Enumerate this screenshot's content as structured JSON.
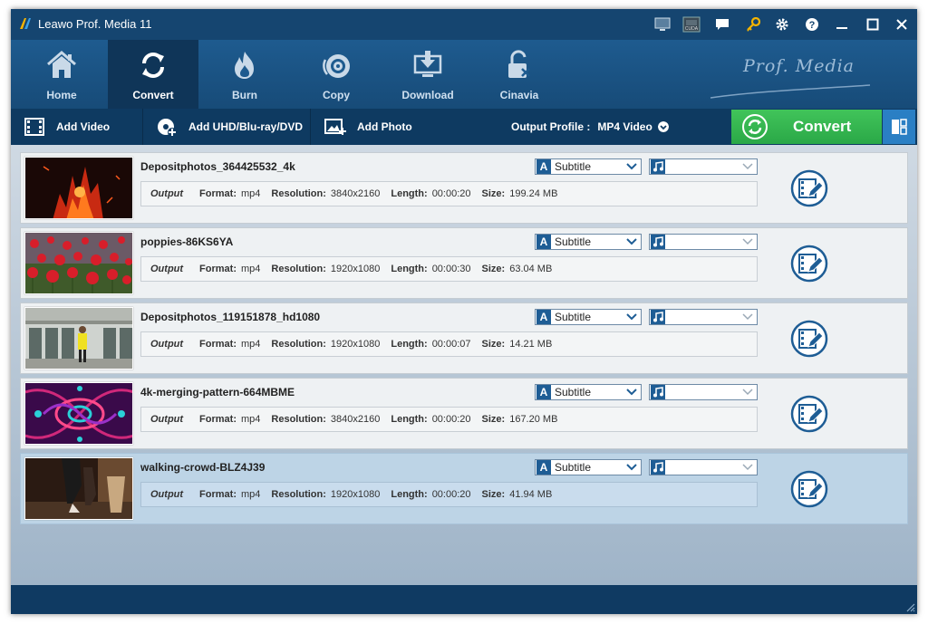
{
  "window": {
    "title": "Leawo Prof. Media 11"
  },
  "titlebar_icons": [
    "monitor-icon",
    "cuda-icon",
    "chat-icon",
    "key-icon",
    "gear-icon",
    "help-icon",
    "minimize-icon",
    "maximize-icon",
    "close-icon"
  ],
  "nav": {
    "items": [
      {
        "label": "Home",
        "icon": "home-icon"
      },
      {
        "label": "Convert",
        "icon": "convert-icon",
        "active": true
      },
      {
        "label": "Burn",
        "icon": "flame-icon"
      },
      {
        "label": "Copy",
        "icon": "disc-copy-icon"
      },
      {
        "label": "Download",
        "icon": "download-icon"
      },
      {
        "label": "Cinavia",
        "icon": "unlock-icon"
      }
    ],
    "brand": "Prof. Media"
  },
  "toolbar": {
    "add_video": "Add Video",
    "add_disc": "Add UHD/Blu-ray/DVD",
    "add_photo": "Add Photo",
    "output_profile_label": "Output Profile :",
    "output_profile_value": "MP4 Video",
    "convert": "Convert"
  },
  "labels": {
    "output": "Output",
    "format": "Format:",
    "resolution": "Resolution:",
    "length": "Length:",
    "size": "Size:",
    "subtitle": "Subtitle"
  },
  "files": [
    {
      "name": "Depositphotos_364425532_4k",
      "format": "mp4",
      "resolution": "3840x2160",
      "length": "00:00:20",
      "size": "199.24 MB",
      "thumb": "fire"
    },
    {
      "name": "poppies-86KS6YA",
      "format": "mp4",
      "resolution": "1920x1080",
      "length": "00:00:30",
      "size": "63.04 MB",
      "thumb": "poppies"
    },
    {
      "name": "Depositphotos_119151878_hd1080",
      "format": "mp4",
      "resolution": "1920x1080",
      "length": "00:00:07",
      "size": "14.21 MB",
      "thumb": "building"
    },
    {
      "name": "4k-merging-pattern-664MBME",
      "format": "mp4",
      "resolution": "3840x2160",
      "length": "00:00:20",
      "size": "167.20 MB",
      "thumb": "pattern"
    },
    {
      "name": "walking-crowd-BLZ4J39",
      "format": "mp4",
      "resolution": "1920x1080",
      "length": "00:00:20",
      "size": "41.94 MB",
      "thumb": "crowd",
      "selected": true
    }
  ]
}
